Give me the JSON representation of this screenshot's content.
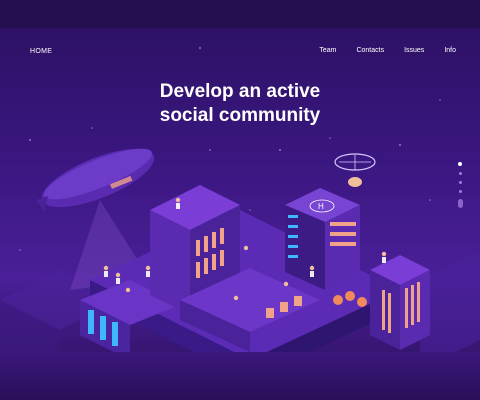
{
  "nav": {
    "home": "HOME",
    "links": [
      "Team",
      "Contacts",
      "Issues",
      "Info"
    ]
  },
  "hero": {
    "line1": "Develop an active",
    "line2": "social community"
  },
  "pager": {
    "count": 5,
    "active_index": 0
  },
  "icons": {
    "helipad": "helipad-h-icon",
    "blimp": "blimp-icon",
    "drone": "drone-icon"
  },
  "colors": {
    "background": "#3a1780",
    "window_warm": "#f0a38a",
    "window_cool": "#3fb7ff",
    "building": "#6a34c7"
  }
}
